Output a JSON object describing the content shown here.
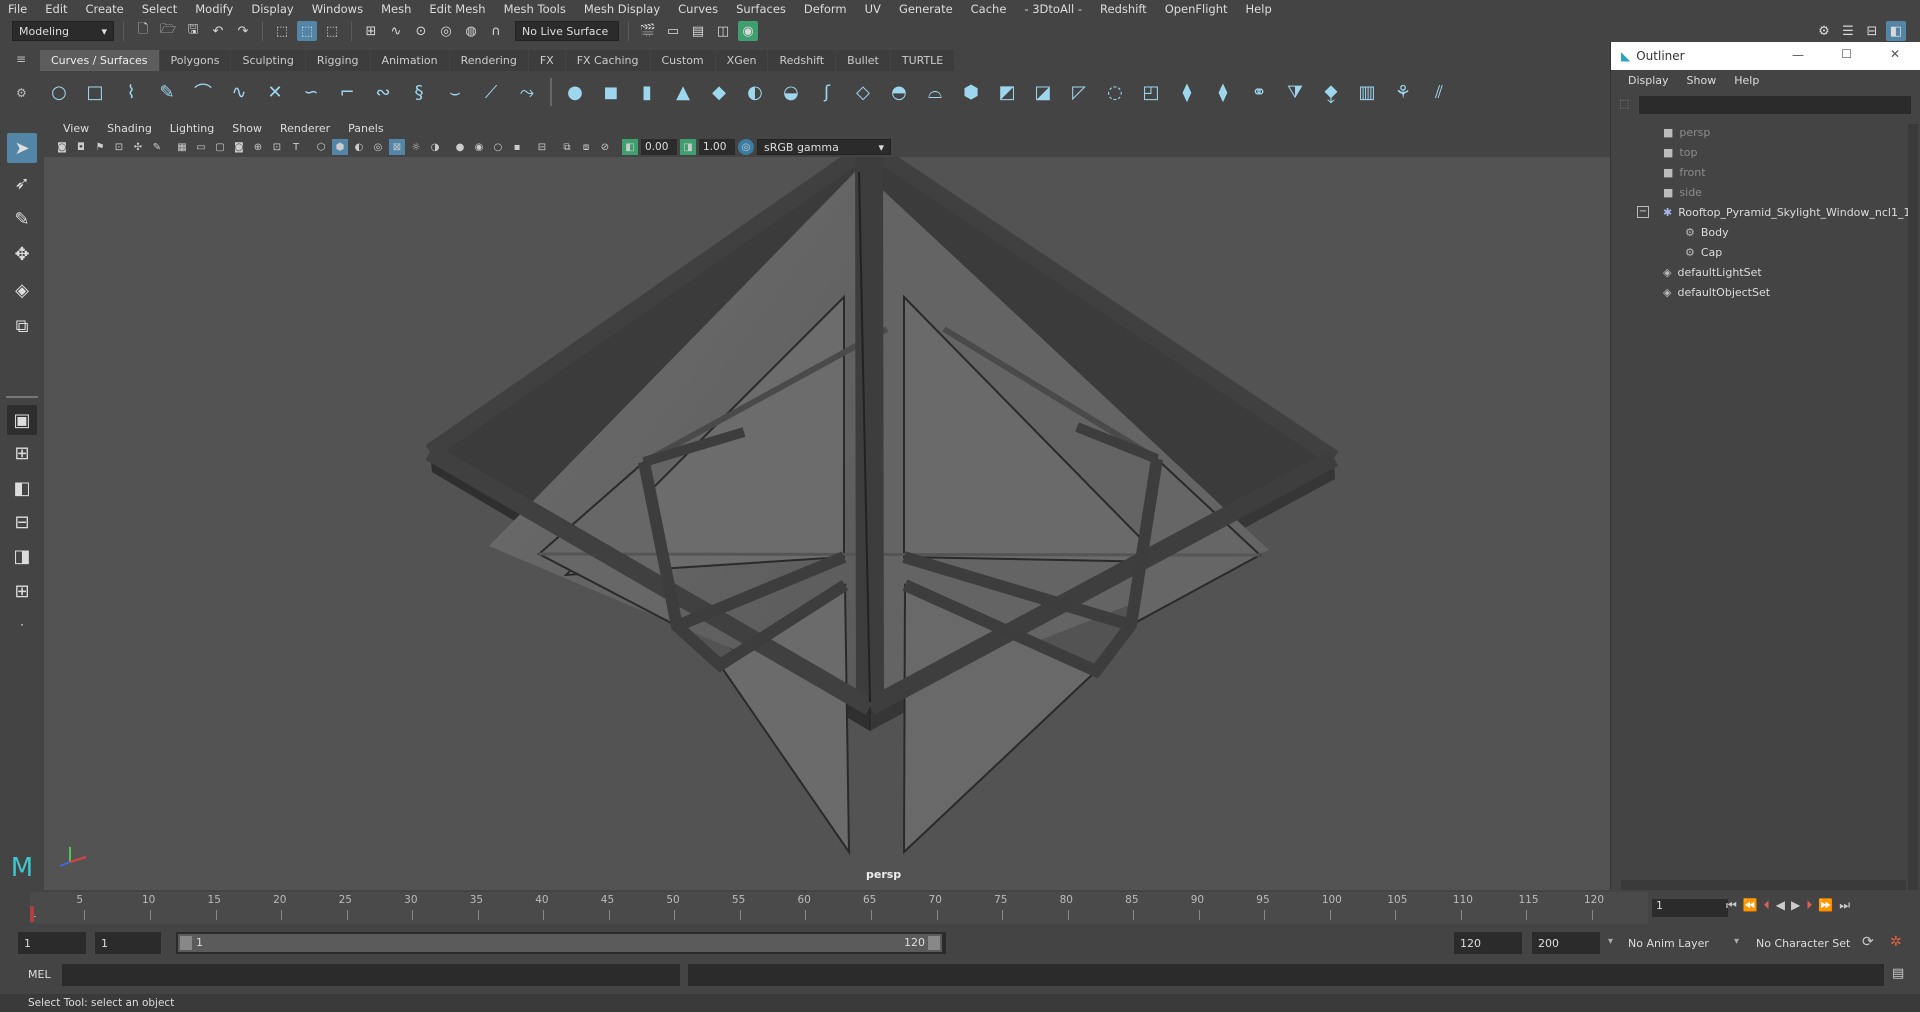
{
  "menubar": {
    "items": [
      "File",
      "Edit",
      "Create",
      "Select",
      "Modify",
      "Display",
      "Windows",
      "Mesh",
      "Edit Mesh",
      "Mesh Tools",
      "Mesh Display",
      "Curves",
      "Surfaces",
      "Deform",
      "UV",
      "Generate",
      "Cache",
      "- 3DtoAll -",
      "Redshift",
      "OpenFlight",
      "Help"
    ]
  },
  "statusline": {
    "mode": "Modeling",
    "live_surface": "No Live Surface"
  },
  "shelf": {
    "tabs": [
      "Curves / Surfaces",
      "Polygons",
      "Sculpting",
      "Rigging",
      "Animation",
      "Rendering",
      "FX",
      "FX Caching",
      "Custom",
      "XGen",
      "Redshift",
      "Bullet",
      "TURTLE"
    ],
    "active_tab": "Curves / Surfaces"
  },
  "viewport": {
    "menu": [
      "View",
      "Shading",
      "Lighting",
      "Show",
      "Renderer",
      "Panels"
    ],
    "exposure": "0.00",
    "gamma": "1.00",
    "color_space": "sRGB gamma",
    "camera_label": "persp"
  },
  "outliner": {
    "title": "Outliner",
    "menu": [
      "Display",
      "Show",
      "Help"
    ],
    "items": [
      {
        "label": "persp",
        "icon": "camera-icon",
        "dim": true
      },
      {
        "label": "top",
        "icon": "camera-icon",
        "dim": true
      },
      {
        "label": "front",
        "icon": "camera-icon",
        "dim": true
      },
      {
        "label": "side",
        "icon": "camera-icon",
        "dim": true
      },
      {
        "label": "Rooftop_Pyramid_Skylight_Window_ncl1_1",
        "icon": "group-icon",
        "dim": false
      },
      {
        "label": "Body",
        "icon": "mesh-icon",
        "dim": false
      },
      {
        "label": "Cap",
        "icon": "mesh-icon",
        "dim": false
      },
      {
        "label": "defaultLightSet",
        "icon": "set-icon",
        "dim": false
      },
      {
        "label": "defaultObjectSet",
        "icon": "set-icon",
        "dim": false
      }
    ]
  },
  "timeline": {
    "ticks": [
      "1",
      "5",
      "10",
      "15",
      "20",
      "25",
      "30",
      "35",
      "40",
      "45",
      "50",
      "55",
      "60",
      "65",
      "70",
      "75",
      "80",
      "85",
      "90",
      "95",
      "100",
      "105",
      "110",
      "115",
      "120"
    ],
    "current_frame": "1"
  },
  "range": {
    "start": "1",
    "playback_start": "1",
    "slider_start": "1",
    "slider_end": "120",
    "playback_end": "120",
    "end": "200",
    "anim_layer": "No Anim Layer",
    "character_set": "No Character Set"
  },
  "command": {
    "label": "MEL"
  },
  "helpline": {
    "text": "Select Tool: select an object"
  }
}
